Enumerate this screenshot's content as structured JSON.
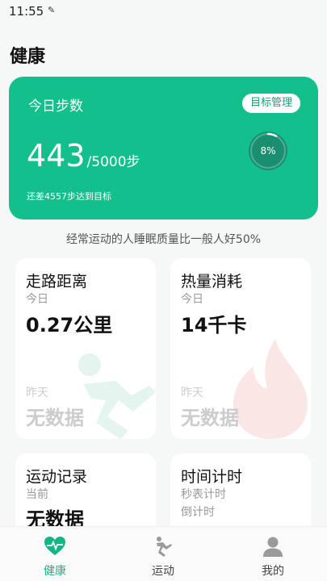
{
  "status_bar": {
    "time": "11:55",
    "icon": "✎"
  },
  "page": {
    "title": "健康"
  },
  "hero": {
    "title": "今日步数",
    "goal_button": "目标管理",
    "steps_value": "443",
    "steps_target": "/5000步",
    "progress_percent": 8,
    "progress_label": "8%",
    "subtitle": "还差4557步达到目标"
  },
  "tip": "经常运动的人睡眠质量比一般人好50%",
  "cards": {
    "walk": {
      "title": "走路距离",
      "today_label": "今日",
      "today_value": "0.27公里",
      "yesterday_label": "昨天",
      "yesterday_value": "无数据",
      "icon": "running-figure-icon"
    },
    "calories": {
      "title": "热量消耗",
      "today_label": "今日",
      "today_value": "14千卡",
      "yesterday_label": "昨天",
      "yesterday_value": "无数据",
      "icon": "flame-icon"
    },
    "records": {
      "title": "运动记录",
      "current_label": "当前",
      "current_value": "无数据"
    },
    "timer": {
      "title": "时间计时",
      "line1": "秒表计时",
      "line2": "倒计时"
    }
  },
  "nav": {
    "items": [
      {
        "label": "健康",
        "icon": "heart-pulse-icon",
        "active": true
      },
      {
        "label": "运动",
        "icon": "run-icon",
        "active": false
      },
      {
        "label": "我的",
        "icon": "person-icon",
        "active": false
      }
    ]
  },
  "colors": {
    "accent": "#13c08d",
    "accent_text": "#13b584",
    "muted": "#999999",
    "faded": "#cccccc"
  }
}
